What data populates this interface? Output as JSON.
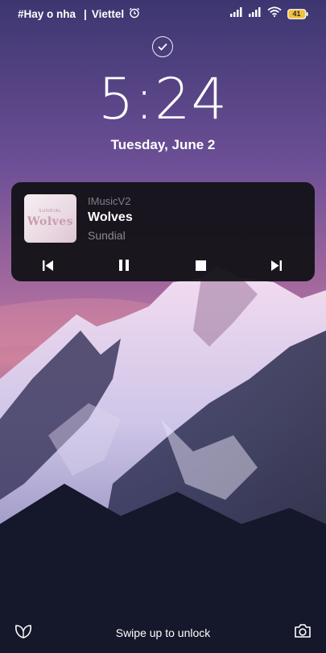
{
  "status_bar": {
    "carrier_text": "#Hay o nha",
    "separator": "|",
    "operator": "Viettel",
    "battery": "41",
    "alarm_icon": "alarm-clock-icon",
    "signal_icon": "cell-signal-icon",
    "wifi_icon": "wifi-icon",
    "battery_icon": "battery-icon"
  },
  "lock": {
    "icon": "check-circle-icon"
  },
  "clock": {
    "time": "5:24",
    "date": "Tuesday, June 2"
  },
  "media": {
    "app_name": "IMusicV2",
    "track_title": "Wolves",
    "artist": "Sundial",
    "album_art_small_text": "SUNDIAL",
    "album_art_title": "Wolves",
    "controls": [
      "previous",
      "pause",
      "stop",
      "next"
    ]
  },
  "bottom": {
    "unlock_hint": "Swipe up to unlock",
    "left_icon": "leaf-icon",
    "right_icon": "camera-icon"
  },
  "colors": {
    "card_bg": "#101014",
    "battery_fill": "#f2c03a",
    "text_primary": "#ffffff",
    "text_secondary": "#8b8b90"
  }
}
